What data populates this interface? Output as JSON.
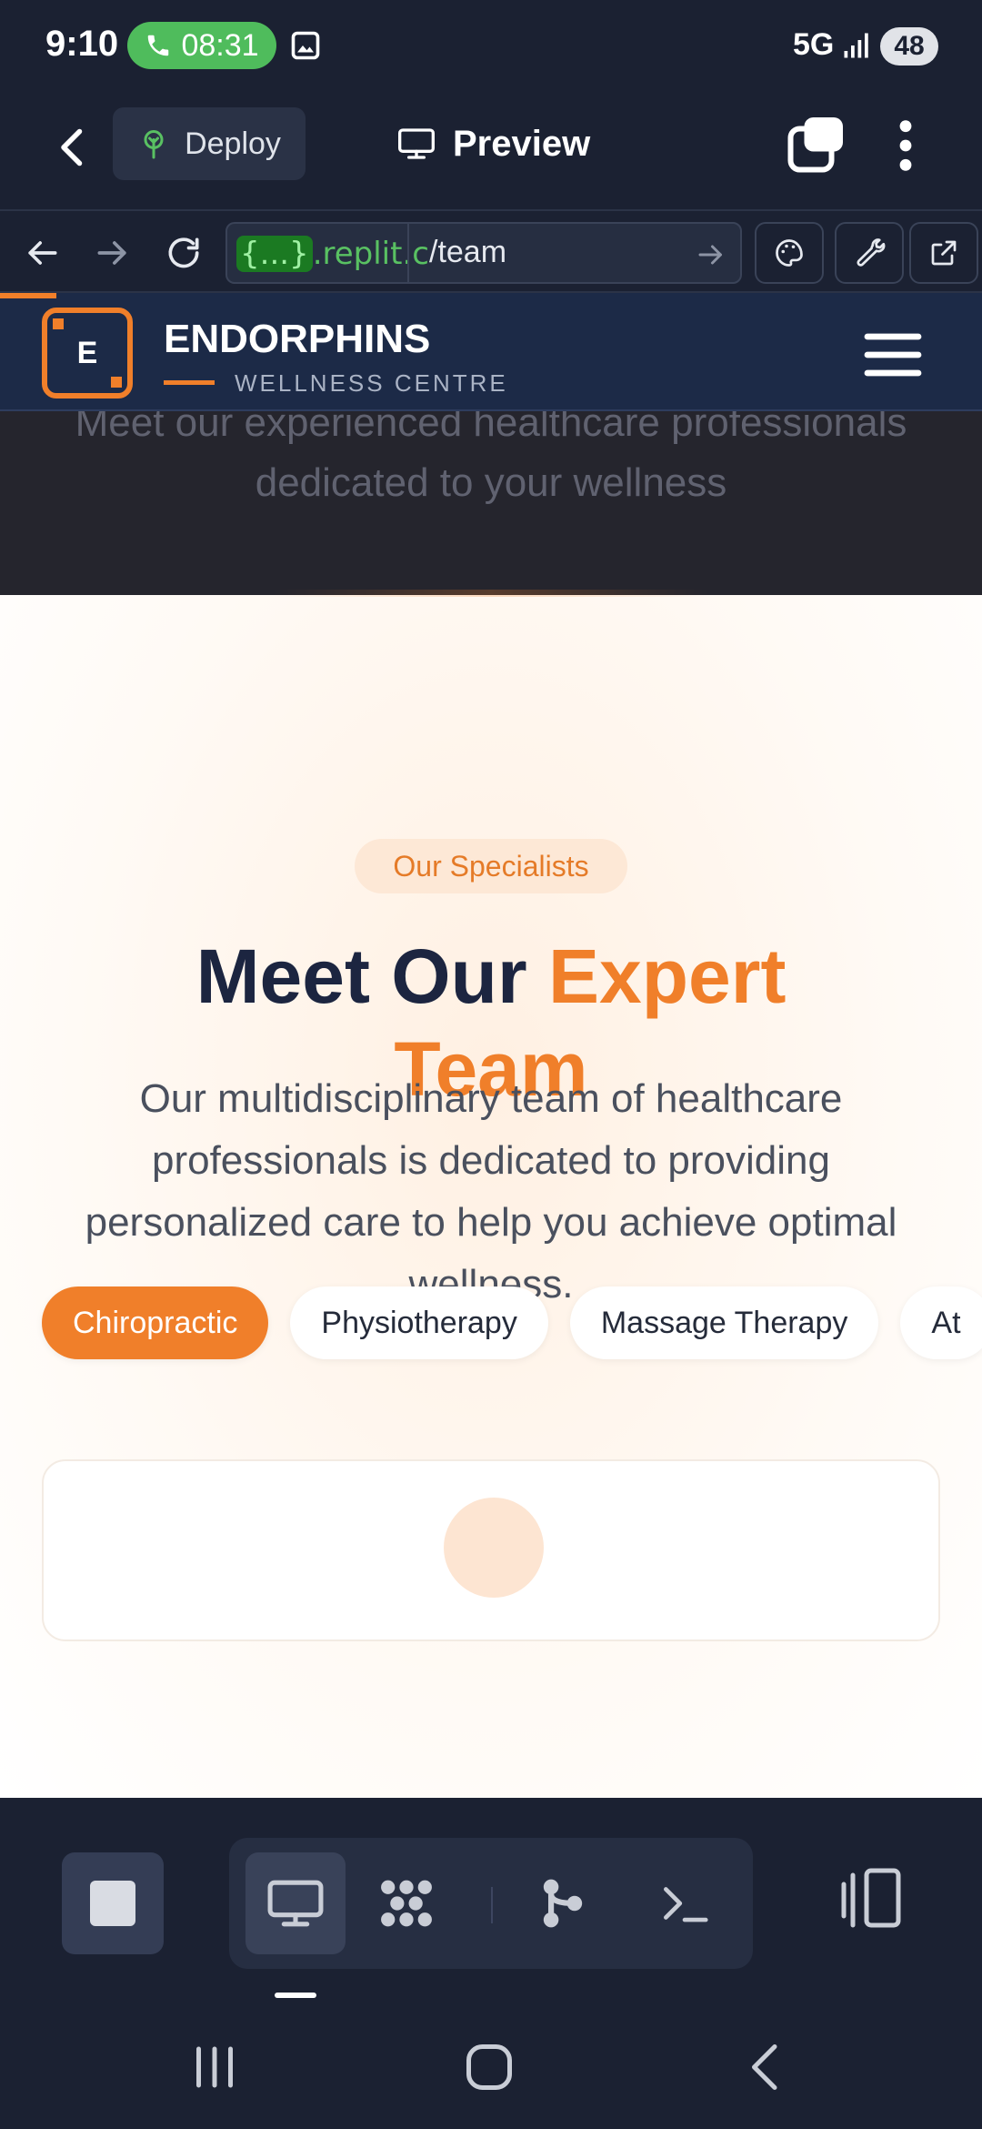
{
  "status_bar": {
    "time": "9:10",
    "call_timer": "08:31",
    "network": "5G",
    "battery": "48"
  },
  "app_header": {
    "deploy_label": "Deploy",
    "preview_label": "Preview"
  },
  "browser": {
    "url_curly": "{...}",
    "url_host": ".replit.c",
    "url_path": "/team"
  },
  "site": {
    "brand_letter": "E",
    "brand_name": "ENDORPHINS",
    "brand_sub": "WELLNESS CENTRE",
    "hero_subtitle_line1": "Meet our experienced healthcare professionals",
    "hero_subtitle_line2": "dedicated to your wellness",
    "badge": "Our Specialists",
    "heading_part1": "Meet Our ",
    "heading_accent_line1": "Expert",
    "heading_accent_line2": "Team",
    "description": "Our multidisciplinary team of healthcare professionals is dedicated to providing personalized care to help you achieve optimal wellness.",
    "filters": [
      {
        "label": "Chiropractic",
        "active": true
      },
      {
        "label": "Physiotherapy",
        "active": false
      },
      {
        "label": "Massage Therapy",
        "active": false
      },
      {
        "label": "At",
        "active": false
      }
    ]
  },
  "colors": {
    "accent": "#f07f2a",
    "navy": "#1c2a47",
    "replit_bg": "#1b2132",
    "call_green": "#4fbc5c"
  },
  "icons": {
    "dock": [
      "monitor-icon",
      "packages-icon",
      "git-icon",
      "terminal-icon"
    ]
  }
}
